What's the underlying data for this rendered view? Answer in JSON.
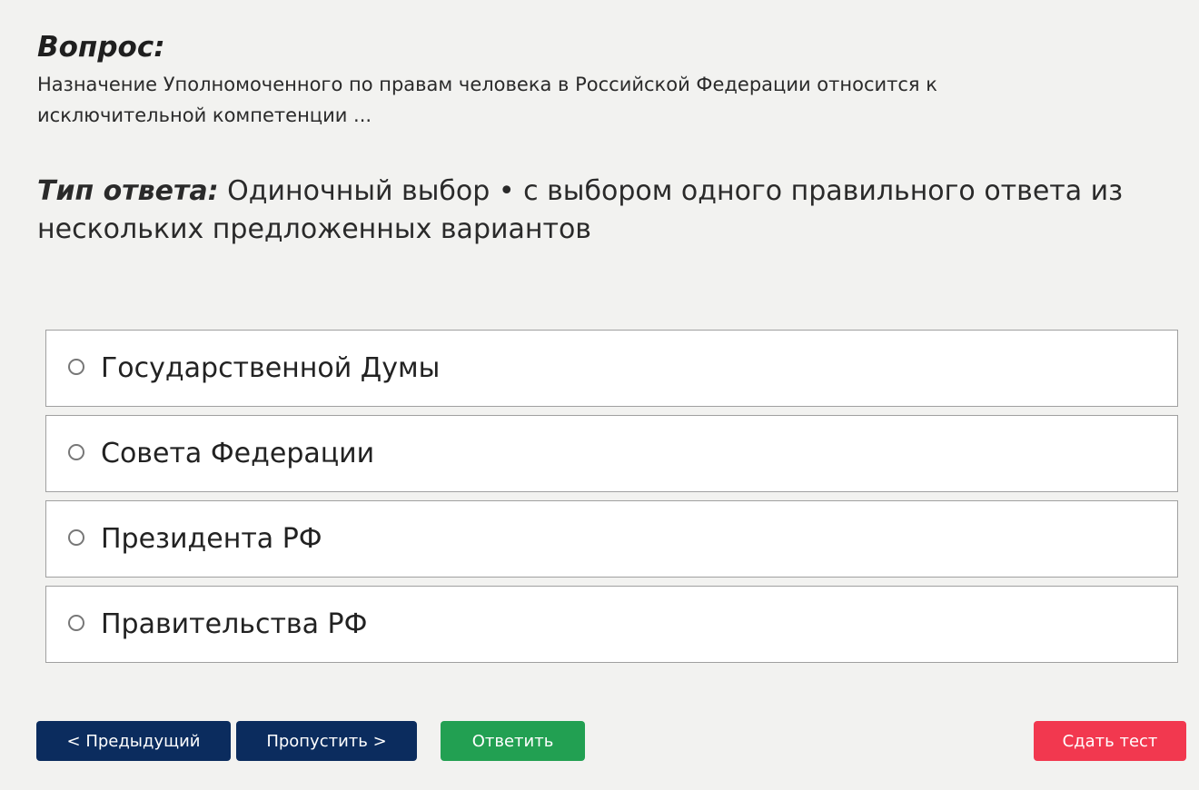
{
  "question": {
    "heading": "Вопрос:",
    "text": "Назначение Уполномоченного по правам человека в Российской Федерации относится к исключительной компетенции ..."
  },
  "answer_type": {
    "label": "Тип ответа:",
    "value": "Одиночный выбор • с выбором одного правильного ответа из нескольких предложенных вариантов"
  },
  "options": [
    {
      "label": "Государственной Думы",
      "selected": false
    },
    {
      "label": "Совета Федерации",
      "selected": false
    },
    {
      "label": "Президента РФ",
      "selected": false
    },
    {
      "label": "Правительства РФ",
      "selected": false
    }
  ],
  "buttons": {
    "prev": "< Предыдущий",
    "skip": "Пропустить >",
    "answer": "Ответить",
    "submit": "Сдать тест"
  },
  "colors": {
    "background": "#f2f2f0",
    "nav_button": "#0b2c5e",
    "answer_button": "#22a052",
    "submit_button": "#f2384f"
  }
}
